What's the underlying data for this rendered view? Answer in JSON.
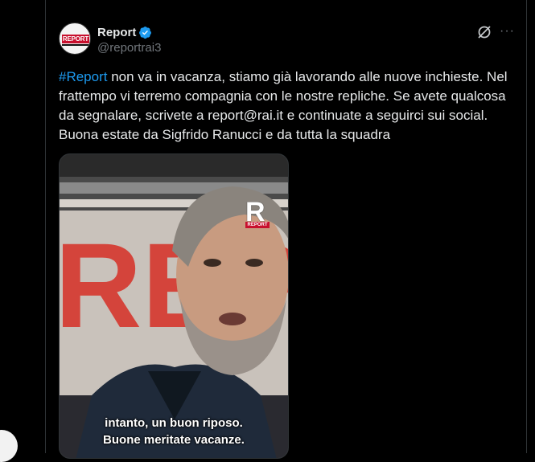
{
  "account": {
    "display_name": "Report",
    "handle": "@reportrai3",
    "avatar_logo_text": "REPORT",
    "verified_color": "#1d9bf0"
  },
  "tweet": {
    "hashtag": "#Report",
    "body": " non va in vacanza, stiamo già lavorando alle nuove inchieste. Nel frattempo vi terremo compagnia con le nostre repliche. Se avete qualcosa da segnalare, scrivete a report@rai.it e continuate a seguirci sui social. Buona estate da Sigfrido Ranucci e da tutta la squadra"
  },
  "media": {
    "caption_line1": "intanto, un buon riposo.",
    "caption_line2": "Buone meritate vacanze.",
    "watermark_letter": "R",
    "watermark_text": "REPORT",
    "background_text": "REP"
  },
  "icons": {
    "grok": "grok-icon",
    "more": "more-icon",
    "verified": "verified-badge-icon"
  },
  "colors": {
    "link": "#1d9bf0",
    "brand_red": "#c8102e"
  }
}
